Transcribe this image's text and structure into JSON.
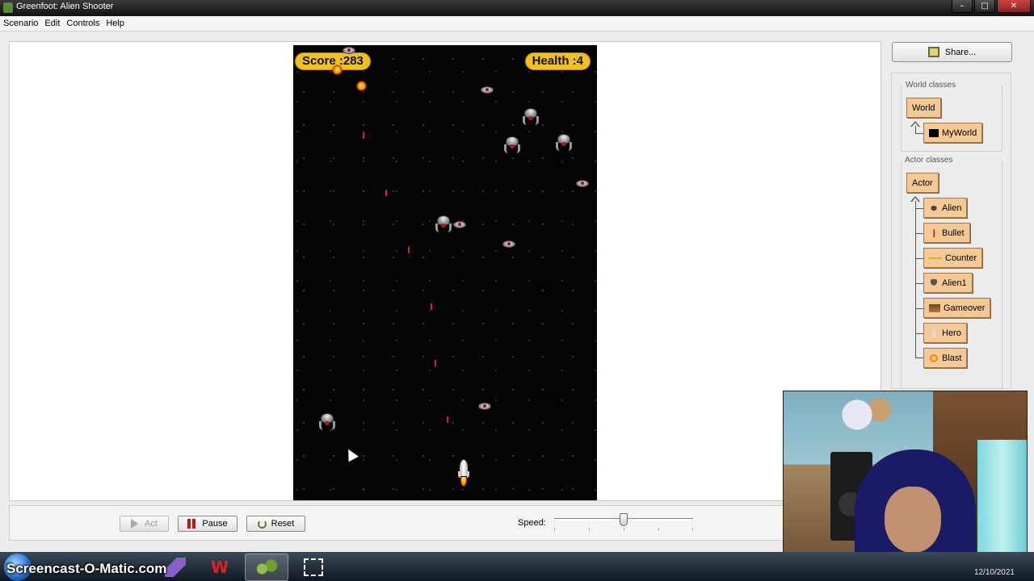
{
  "window": {
    "title": "Greenfoot: Alien Shooter",
    "minimize": "–",
    "maximize": "□",
    "close": "✕"
  },
  "menu": [
    {
      "label": "Scenario"
    },
    {
      "label": "Edit"
    },
    {
      "label": "Controls"
    },
    {
      "label": "Help"
    }
  ],
  "game": {
    "score_text": "Score :283",
    "health_text": "Health :4",
    "background_color": "#050505",
    "hud_color": "#f0c020"
  },
  "share": {
    "label": "Share..."
  },
  "world_classes": {
    "title": "World classes",
    "items": [
      {
        "label": "World",
        "icon": "none"
      },
      {
        "label": "MyWorld",
        "icon": "black-square-icon"
      }
    ]
  },
  "actor_classes": {
    "title": "Actor classes",
    "items": [
      {
        "label": "Actor",
        "icon": "none"
      },
      {
        "label": "Alien",
        "icon": "alien-icon"
      },
      {
        "label": "Bullet",
        "icon": "bullet-icon"
      },
      {
        "label": "Counter",
        "icon": "counter-icon"
      },
      {
        "label": "Alien1",
        "icon": "alien1-icon"
      },
      {
        "label": "Gameover",
        "icon": "gameover-icon"
      },
      {
        "label": "Hero",
        "icon": "hero-icon"
      },
      {
        "label": "Blast",
        "icon": "blast-icon"
      }
    ]
  },
  "controls": {
    "act_label": "Act",
    "pause_label": "Pause",
    "reset_label": "Reset",
    "speed_label": "Speed:",
    "speed_value": 0.5
  },
  "overlay": {
    "watermark": "Screencast-O-Matic.com",
    "clock": "12/10/2021"
  },
  "colors": {
    "class_box": "#f5c996",
    "accent": "#c01818"
  }
}
